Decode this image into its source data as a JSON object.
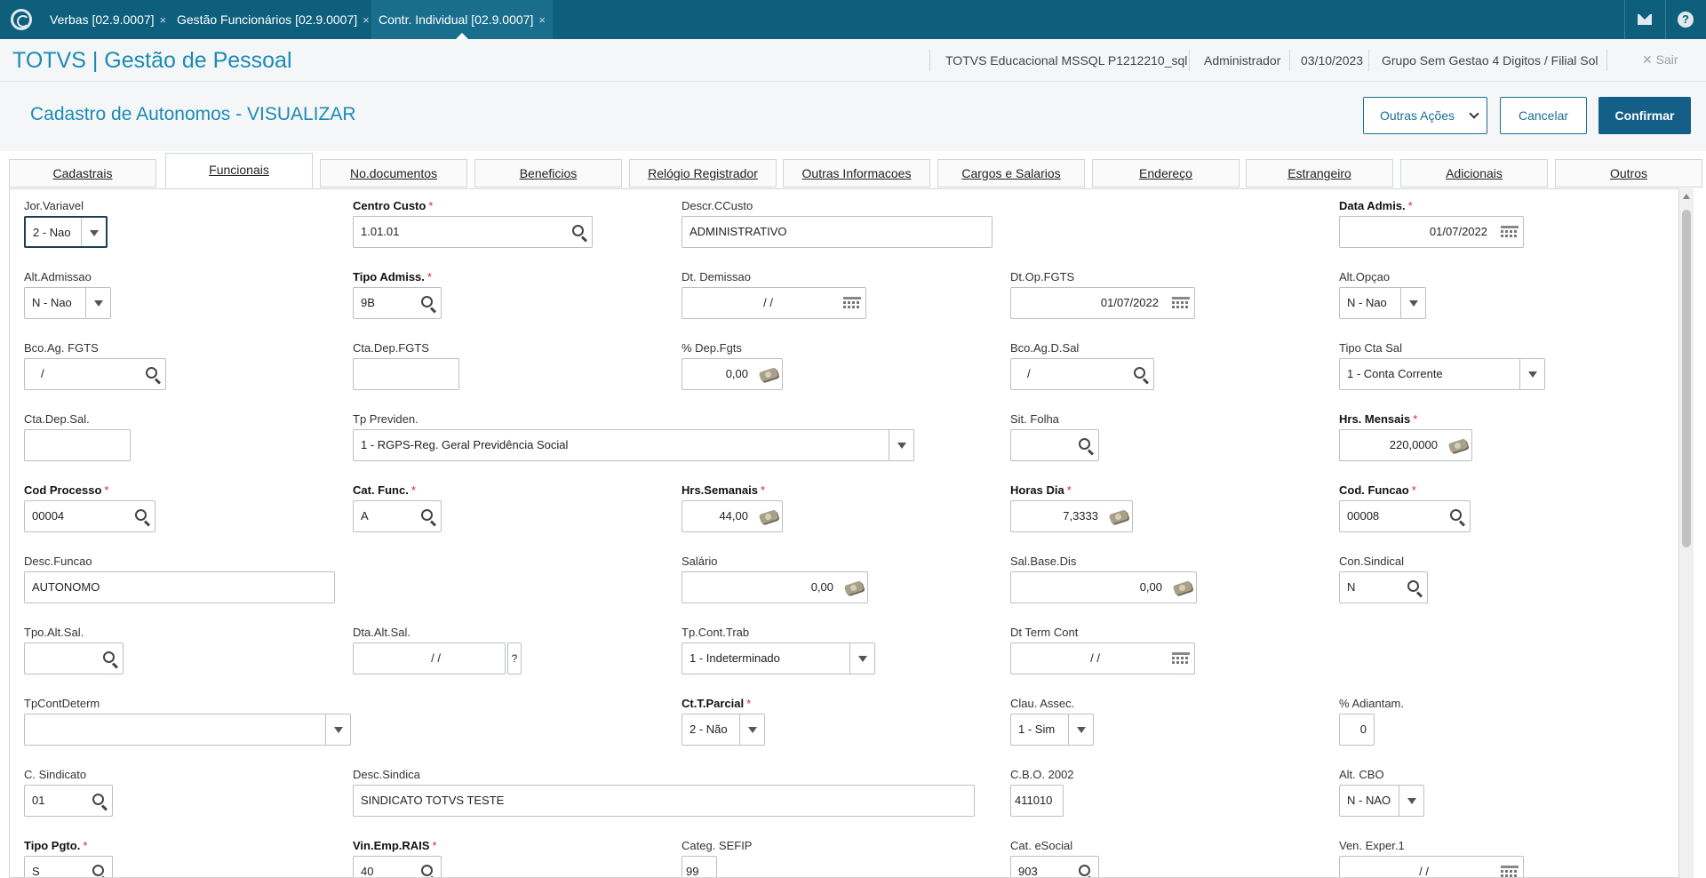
{
  "topbar": {
    "tabs": [
      {
        "label": "Verbas [02.9.0007]",
        "close": "×"
      },
      {
        "label": "Gestão Funcionários [02.9.0007]",
        "close": "×"
      },
      {
        "label": "Contr. Individual [02.9.0007]",
        "close": "×"
      }
    ]
  },
  "header": {
    "brand": "TOTVS | Gestão de Pessoal",
    "environment": "TOTVS Educacional MSSQL P1212210_sql",
    "user": "Administrador",
    "date": "03/10/2023",
    "branch": "Grupo Sem Gestao 4 Digitos / Filial Sol",
    "exit_label": "✕  Sair"
  },
  "page": {
    "title": "Cadastro de Autonomos - VISUALIZAR",
    "actions": {
      "other": "Outras Ações",
      "cancel": "Cancelar",
      "confirm": "Confirmar"
    }
  },
  "tabs": [
    "Cadastrais",
    "Funcionais",
    "No.documentos",
    "Beneficios",
    "Relógio Registrador",
    "Outras Informacoes",
    "Cargos e Salarios",
    "Endereço",
    "Estrangeiro",
    "Adicionais",
    "Outros"
  ],
  "form": {
    "jor_variavel": {
      "label": "Jor.Variavel",
      "value": "2 - Nao"
    },
    "centro_custo": {
      "label": "Centro Custo",
      "value": "1.01.01"
    },
    "descr_ccusto": {
      "label": "Descr.CCusto",
      "value": "ADMINISTRATIVO"
    },
    "data_admis": {
      "label": "Data Admis.",
      "value": "01/07/2022"
    },
    "alt_admissao": {
      "label": "Alt.Admissao",
      "value": "N - Nao"
    },
    "tipo_admiss": {
      "label": "Tipo Admiss.",
      "value": "9B"
    },
    "dt_demissao": {
      "label": "Dt. Demissao",
      "value": "/  /"
    },
    "dt_op_fgts": {
      "label": "Dt.Op.FGTS",
      "value": "01/07/2022"
    },
    "alt_opcao": {
      "label": "Alt.Opçao",
      "value": "N - Nao"
    },
    "bco_ag_fgts": {
      "label": "Bco.Ag. FGTS",
      "value": "/"
    },
    "cta_dep_fgts": {
      "label": "Cta.Dep.FGTS",
      "value": ""
    },
    "pct_dep_fgts": {
      "label": "% Dep.Fgts",
      "value": "0,00"
    },
    "bco_ag_d_sal": {
      "label": "Bco.Ag.D.Sal",
      "value": "/"
    },
    "tipo_cta_sal": {
      "label": "Tipo Cta Sal",
      "value": "1 - Conta Corrente"
    },
    "cta_dep_sal": {
      "label": "Cta.Dep.Sal.",
      "value": ""
    },
    "tp_previden": {
      "label": "Tp Previden.",
      "value": "1 - RGPS-Reg. Geral Previdência Social"
    },
    "sit_folha": {
      "label": "Sit. Folha",
      "value": ""
    },
    "hrs_mensais": {
      "label": "Hrs. Mensais",
      "value": "220,0000"
    },
    "cod_processo": {
      "label": "Cod Processo",
      "value": "00004"
    },
    "cat_func": {
      "label": "Cat. Func.",
      "value": "A"
    },
    "hrs_semanais": {
      "label": "Hrs.Semanais",
      "value": "44,00"
    },
    "horas_dia": {
      "label": "Horas Dia",
      "value": "7,3333"
    },
    "cod_funcao": {
      "label": "Cod. Funcao",
      "value": "00008"
    },
    "desc_funcao": {
      "label": "Desc.Funcao",
      "value": "AUTONOMO"
    },
    "salario": {
      "label": "Salário",
      "value": "0,00"
    },
    "sal_base_dis": {
      "label": "Sal.Base.Dis",
      "value": "0,00"
    },
    "con_sindical": {
      "label": "Con.Sindical",
      "value": "N"
    },
    "tpo_alt_sal": {
      "label": "Tpo.Alt.Sal.",
      "value": ""
    },
    "dta_alt_sal": {
      "label": "Dta.Alt.Sal.",
      "value": "/  /",
      "help": "?"
    },
    "tp_cont_trab": {
      "label": "Tp.Cont.Trab",
      "value": "1 - Indeterminado"
    },
    "dt_term_cont": {
      "label": "Dt Term Cont",
      "value": "/  /"
    },
    "tp_cont_determ": {
      "label": "TpContDeterm",
      "value": ""
    },
    "ct_t_parcial": {
      "label": "Ct.T.Parcial",
      "value": "2 - Não"
    },
    "clau_assec": {
      "label": "Clau. Assec.",
      "value": "1 - Sim"
    },
    "pct_adiantam": {
      "label": "% Adiantam.",
      "value": "0"
    },
    "c_sindicato": {
      "label": "C. Sindicato",
      "value": "01"
    },
    "desc_sindica": {
      "label": "Desc.Sindica",
      "value": "SINDICATO TOTVS TESTE"
    },
    "cbo_2002": {
      "label": "C.B.O. 2002",
      "value": "411010"
    },
    "alt_cbo": {
      "label": "Alt. CBO",
      "value": "N - NAO"
    },
    "tipo_pgto": {
      "label": "Tipo Pgto.",
      "value": "S"
    },
    "vin_emp_rais": {
      "label": "Vin.Emp.RAIS",
      "value": "40"
    },
    "categ_sefip": {
      "label": "Categ. SEFIP",
      "value": "99"
    },
    "cat_esocial": {
      "label": "Cat. eSocial",
      "value": "903"
    },
    "ven_exper_1": {
      "label": "Ven. Exper.1",
      "value": "/  /"
    }
  }
}
